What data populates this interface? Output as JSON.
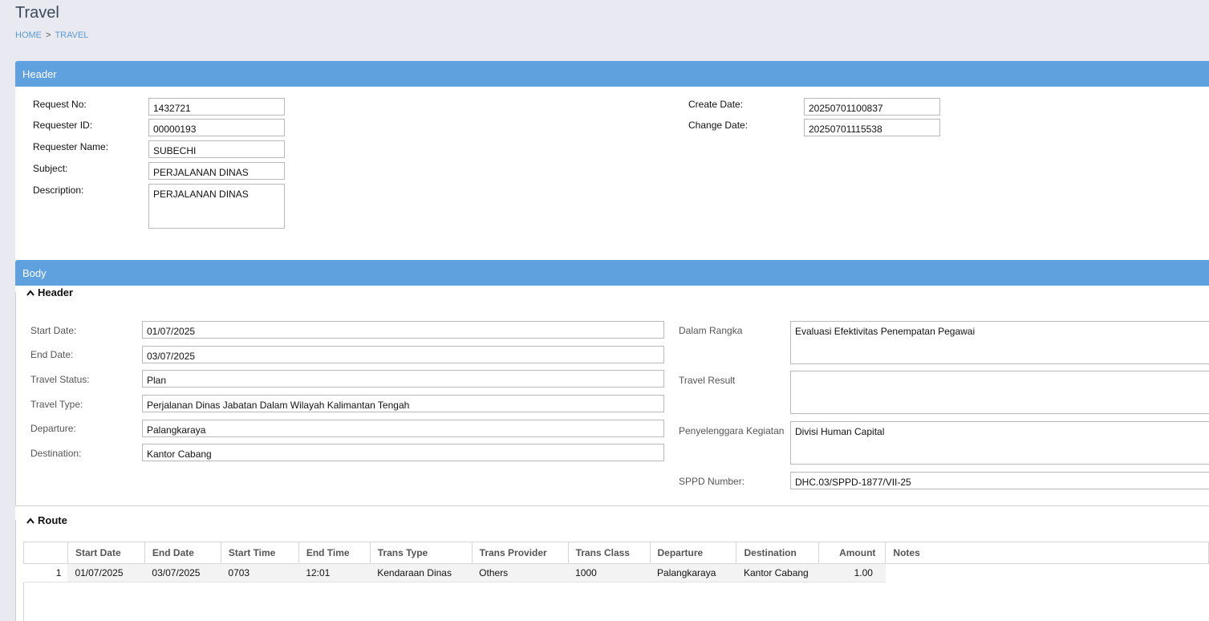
{
  "page": {
    "title": "Travel",
    "breadcrumb": {
      "home": "HOME",
      "separator": ">",
      "current": "TRAVEL"
    }
  },
  "header_panel": {
    "title": "Header",
    "request_no": {
      "label": "Request No:",
      "value": "1432721"
    },
    "requester_id": {
      "label": "Requester ID:",
      "value": "00000193"
    },
    "requester_name": {
      "label": "Requester Name:",
      "value": "SUBECHI"
    },
    "subject": {
      "label": "Subject:",
      "value": "PERJALANAN DINAS"
    },
    "description": {
      "label": "Description:",
      "value": "PERJALANAN DINAS"
    },
    "create_date": {
      "label": "Create Date:",
      "value": "20250701100837"
    },
    "change_date": {
      "label": "Change Date:",
      "value": "20250701115538"
    }
  },
  "body_panel": {
    "title": "Body",
    "header_section": {
      "title": "Header",
      "start_date": {
        "label": "Start Date:",
        "value": "01/07/2025"
      },
      "end_date": {
        "label": "End Date:",
        "value": "03/07/2025"
      },
      "travel_status": {
        "label": "Travel Status:",
        "value": "Plan"
      },
      "travel_type": {
        "label": "Travel Type:",
        "value": "Perjalanan Dinas Jabatan Dalam Wilayah Kalimantan Tengah"
      },
      "departure": {
        "label": "Departure:",
        "value": "Palangkaraya"
      },
      "destination": {
        "label": "Destination:",
        "value": "Kantor Cabang"
      },
      "dalam_rangka": {
        "label": "Dalam Rangka",
        "value": "Evaluasi Efektivitas Penempatan Pegawai"
      },
      "travel_result": {
        "label": "Travel Result",
        "value": ""
      },
      "penyelenggara": {
        "label": "Penyelenggara Kegiatan",
        "value": "Divisi Human Capital"
      },
      "sppd_number": {
        "label": "SPPD Number:",
        "value": "DHC.03/SPPD-1877/VII-25"
      }
    },
    "route_section": {
      "title": "Route",
      "columns": [
        "Start Date",
        "End Date",
        "Start Time",
        "End Time",
        "Trans Type",
        "Trans Provider",
        "Trans Class",
        "Departure",
        "Destination",
        "Amount",
        "Notes"
      ],
      "rows": [
        {
          "no": "1",
          "start_date": "01/07/2025",
          "end_date": "03/07/2025",
          "start_time": "0703",
          "end_time": "12:01",
          "trans_type": "Kendaraan Dinas",
          "trans_provider": "Others",
          "trans_class": "1000",
          "departure": "Palangkaraya",
          "destination": "Kantor Cabang",
          "amount": "1.00",
          "notes": ""
        }
      ]
    }
  },
  "icons": {
    "collapse": "chevron-up-icon"
  }
}
